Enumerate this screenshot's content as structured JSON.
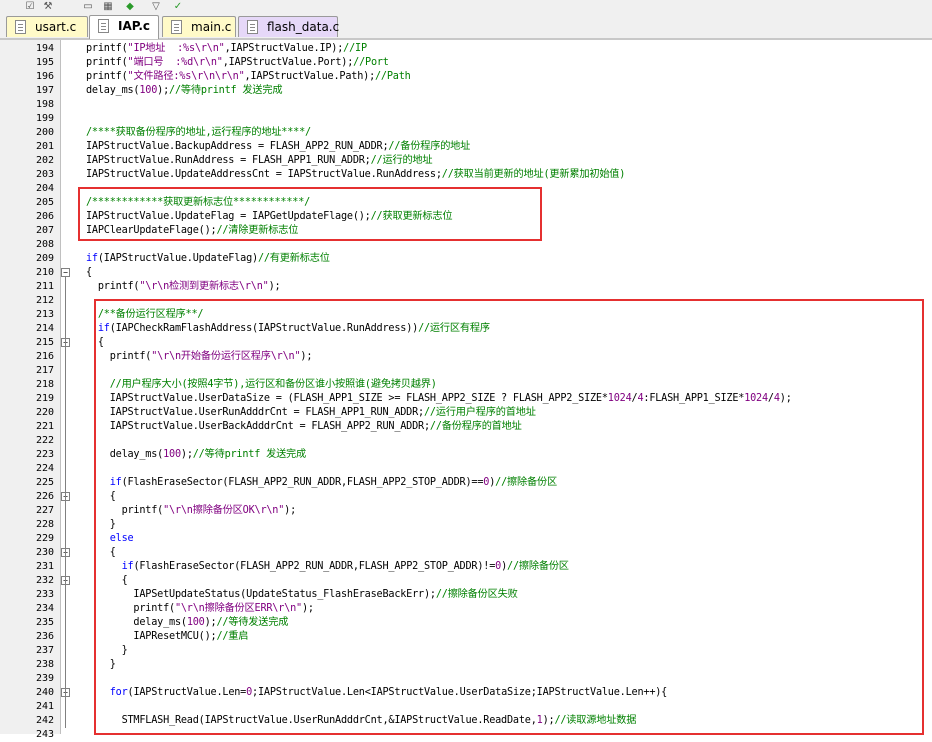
{
  "tabs": [
    {
      "label": "usart.c",
      "active": false,
      "color": "#fffac8"
    },
    {
      "label": "IAP.c",
      "active": true,
      "color": "#ffffff"
    },
    {
      "label": "main.c",
      "active": false,
      "color": "#fffac8"
    },
    {
      "label": "flash_data.c",
      "active": false,
      "color": "#e6d8f8"
    }
  ],
  "lines": [
    {
      "n": "194",
      "fold": "",
      "code": [
        [
          "",
          "printf("
        ],
        [
          "s",
          "\"IP地址  :%s\\r\\n\""
        ],
        [
          "",
          ",IAPStructValue.IP);"
        ],
        [
          "c",
          "//IP"
        ]
      ]
    },
    {
      "n": "195",
      "fold": "",
      "code": [
        [
          "",
          "printf("
        ],
        [
          "s",
          "\"端口号  :%d\\r\\n\""
        ],
        [
          "",
          ",IAPStructValue.Port);"
        ],
        [
          "c",
          "//Port"
        ]
      ]
    },
    {
      "n": "196",
      "fold": "",
      "code": [
        [
          "",
          "printf("
        ],
        [
          "s",
          "\"文件路径:%s\\r\\n\\r\\n\""
        ],
        [
          "",
          ",IAPStructValue.Path);"
        ],
        [
          "c",
          "//Path"
        ]
      ]
    },
    {
      "n": "197",
      "fold": "",
      "code": [
        [
          "",
          "delay_ms("
        ],
        [
          "n",
          "100"
        ],
        [
          "",
          ");"
        ],
        [
          "c",
          "//等待printf 发送完成"
        ]
      ]
    },
    {
      "n": "198",
      "fold": "",
      "code": []
    },
    {
      "n": "199",
      "fold": "",
      "code": []
    },
    {
      "n": "200",
      "fold": "",
      "code": [
        [
          "c",
          "/****获取备份程序的地址,运行程序的地址****/"
        ]
      ]
    },
    {
      "n": "201",
      "fold": "",
      "code": [
        [
          "",
          "IAPStructValue.BackupAddress = FLASH_APP2_RUN_ADDR;"
        ],
        [
          "c",
          "//备份程序的地址"
        ]
      ]
    },
    {
      "n": "202",
      "fold": "",
      "code": [
        [
          "",
          "IAPStructValue.RunAddress = FLASH_APP1_RUN_ADDR;"
        ],
        [
          "c",
          "//运行的地址"
        ]
      ]
    },
    {
      "n": "203",
      "fold": "",
      "code": [
        [
          "",
          "IAPStructValue.UpdateAddressCnt = IAPStructValue.RunAddress;"
        ],
        [
          "c",
          "//获取当前更新的地址(更新累加初始值)"
        ]
      ]
    },
    {
      "n": "204",
      "fold": "",
      "code": []
    },
    {
      "n": "205",
      "fold": "",
      "code": [
        [
          "c",
          "/************获取更新标志位************/"
        ]
      ]
    },
    {
      "n": "206",
      "fold": "",
      "code": [
        [
          "",
          "IAPStructValue.UpdateFlag = IAPGetUpdateFlage();"
        ],
        [
          "c",
          "//获取更新标志位"
        ]
      ]
    },
    {
      "n": "207",
      "fold": "",
      "code": [
        [
          "",
          "IAPClearUpdateFlage();"
        ],
        [
          "c",
          "//清除更新标志位"
        ]
      ]
    },
    {
      "n": "208",
      "fold": "",
      "code": []
    },
    {
      "n": "209",
      "fold": "",
      "code": [
        [
          "k",
          "if"
        ],
        [
          "",
          "(IAPStructValue.UpdateFlag)"
        ],
        [
          "c",
          "//有更新标志位"
        ]
      ]
    },
    {
      "n": "210",
      "fold": "open",
      "code": [
        [
          "",
          "{"
        ]
      ]
    },
    {
      "n": "211",
      "fold": "",
      "code": [
        [
          "",
          "  printf("
        ],
        [
          "s",
          "\"\\r\\n检测到更新标志\\r\\n\""
        ],
        [
          "",
          ");"
        ]
      ]
    },
    {
      "n": "212",
      "fold": "",
      "code": []
    },
    {
      "n": "213",
      "fold": "",
      "code": [
        [
          "",
          "  "
        ],
        [
          "c",
          "/**备份运行区程序**/"
        ]
      ]
    },
    {
      "n": "214",
      "fold": "",
      "code": [
        [
          "",
          "  "
        ],
        [
          "k",
          "if"
        ],
        [
          "",
          "(IAPCheckRamFlashAddress(IAPStructValue.RunAddress))"
        ],
        [
          "c",
          "//运行区有程序"
        ]
      ]
    },
    {
      "n": "215",
      "fold": "open",
      "code": [
        [
          "",
          "  {"
        ]
      ]
    },
    {
      "n": "216",
      "fold": "",
      "code": [
        [
          "",
          "    printf("
        ],
        [
          "s",
          "\"\\r\\n开始备份运行区程序\\r\\n\""
        ],
        [
          "",
          ");"
        ]
      ]
    },
    {
      "n": "217",
      "fold": "",
      "code": []
    },
    {
      "n": "218",
      "fold": "",
      "code": [
        [
          "",
          "    "
        ],
        [
          "c",
          "//用户程序大小(按照4字节),运行区和备份区谁小按照谁(避免拷贝越界)"
        ]
      ]
    },
    {
      "n": "219",
      "fold": "",
      "code": [
        [
          "",
          "    IAPStructValue.UserDataSize = (FLASH_APP1_SIZE >= FLASH_APP2_SIZE ? FLASH_APP2_SIZE*"
        ],
        [
          "n",
          "1024"
        ],
        [
          "",
          "/"
        ],
        [
          "n",
          "4"
        ],
        [
          "",
          ":FLASH_APP1_SIZE*"
        ],
        [
          "n",
          "1024"
        ],
        [
          "",
          "/"
        ],
        [
          "n",
          "4"
        ],
        [
          "",
          ");"
        ]
      ]
    },
    {
      "n": "220",
      "fold": "",
      "code": [
        [
          "",
          "    IAPStructValue.UserRunAdddrCnt = FLASH_APP1_RUN_ADDR;"
        ],
        [
          "c",
          "//运行用户程序的首地址"
        ]
      ]
    },
    {
      "n": "221",
      "fold": "",
      "code": [
        [
          "",
          "    IAPStructValue.UserBackAdddrCnt = FLASH_APP2_RUN_ADDR;"
        ],
        [
          "c",
          "//备份程序的首地址"
        ]
      ]
    },
    {
      "n": "222",
      "fold": "",
      "code": []
    },
    {
      "n": "223",
      "fold": "",
      "code": [
        [
          "",
          "    delay_ms("
        ],
        [
          "n",
          "100"
        ],
        [
          "",
          ");"
        ],
        [
          "c",
          "//等待printf 发送完成"
        ]
      ]
    },
    {
      "n": "224",
      "fold": "",
      "code": []
    },
    {
      "n": "225",
      "fold": "",
      "code": [
        [
          "",
          "    "
        ],
        [
          "k",
          "if"
        ],
        [
          "",
          "(FlashEraseSector(FLASH_APP2_RUN_ADDR,FLASH_APP2_STOP_ADDR)=="
        ],
        [
          "n",
          "0"
        ],
        [
          "",
          ")"
        ],
        [
          "c",
          "//擦除备份区"
        ]
      ]
    },
    {
      "n": "226",
      "fold": "open",
      "code": [
        [
          "",
          "    {"
        ]
      ]
    },
    {
      "n": "227",
      "fold": "",
      "code": [
        [
          "",
          "      printf("
        ],
        [
          "s",
          "\"\\r\\n擦除备份区OK\\r\\n\""
        ],
        [
          "",
          ");"
        ]
      ]
    },
    {
      "n": "228",
      "fold": "",
      "code": [
        [
          "",
          "    }"
        ]
      ]
    },
    {
      "n": "229",
      "fold": "",
      "code": [
        [
          "",
          "    "
        ],
        [
          "k",
          "else"
        ]
      ]
    },
    {
      "n": "230",
      "fold": "open",
      "code": [
        [
          "",
          "    {"
        ]
      ]
    },
    {
      "n": "231",
      "fold": "",
      "code": [
        [
          "",
          "      "
        ],
        [
          "k",
          "if"
        ],
        [
          "",
          "(FlashEraseSector(FLASH_APP2_RUN_ADDR,FLASH_APP2_STOP_ADDR)!="
        ],
        [
          "n",
          "0"
        ],
        [
          "",
          ")"
        ],
        [
          "c",
          "//擦除备份区"
        ]
      ]
    },
    {
      "n": "232",
      "fold": "open",
      "code": [
        [
          "",
          "      {"
        ]
      ]
    },
    {
      "n": "233",
      "fold": "",
      "code": [
        [
          "",
          "        IAPSetUpdateStatus(UpdateStatus_FlashEraseBackErr);"
        ],
        [
          "c",
          "//擦除备份区失败"
        ]
      ]
    },
    {
      "n": "234",
      "fold": "",
      "code": [
        [
          "",
          "        printf("
        ],
        [
          "s",
          "\"\\r\\n擦除备份区ERR\\r\\n\""
        ],
        [
          "",
          ");"
        ]
      ]
    },
    {
      "n": "235",
      "fold": "",
      "code": [
        [
          "",
          "        delay_ms("
        ],
        [
          "n",
          "100"
        ],
        [
          "",
          ");"
        ],
        [
          "c",
          "//等待发送完成"
        ]
      ]
    },
    {
      "n": "236",
      "fold": "",
      "code": [
        [
          "",
          "        IAPResetMCU();"
        ],
        [
          "c",
          "//重启"
        ]
      ]
    },
    {
      "n": "237",
      "fold": "",
      "code": [
        [
          "",
          "      }"
        ]
      ]
    },
    {
      "n": "238",
      "fold": "",
      "code": [
        [
          "",
          "    }"
        ]
      ]
    },
    {
      "n": "239",
      "fold": "",
      "code": []
    },
    {
      "n": "240",
      "fold": "open",
      "code": [
        [
          "",
          "    "
        ],
        [
          "k",
          "for"
        ],
        [
          "",
          "(IAPStructValue.Len="
        ],
        [
          "n",
          "0"
        ],
        [
          "",
          ";IAPStructValue.Len<IAPStructValue.UserDataSize;IAPStructValue.Len++){"
        ]
      ]
    },
    {
      "n": "241",
      "fold": "",
      "code": []
    },
    {
      "n": "242",
      "fold": "",
      "code": [
        [
          "",
          "      STMFLASH_Read(IAPStructValue.UserRunAdddrCnt,&IAPStructValue.ReadDate,"
        ],
        [
          "n",
          "1"
        ],
        [
          "",
          ");"
        ],
        [
          "c",
          "//读取源地址数据"
        ]
      ]
    },
    {
      "n": "243",
      "fold": "",
      "code": []
    }
  ],
  "colors": {
    "keyword": "#0000ff",
    "comment": "#008000",
    "string": "#800080",
    "highlight_box": "#e53030"
  }
}
